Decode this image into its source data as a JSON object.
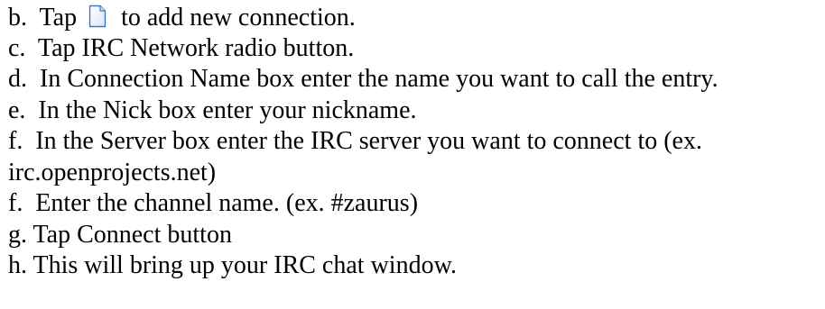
{
  "instructions": {
    "b": {
      "prefix": "b.  Tap ",
      "icon": "new-document-icon",
      "suffix": "  to add new connection."
    },
    "c": "c.  Tap IRC Network radio button.",
    "d": "d.  In Connection Name box enter the name you want to call the entry.",
    "e": "e.  In the Nick box enter your nickname.",
    "f1_line1": "f.  In the Server box enter the IRC server you want to connect to (ex.",
    "f1_line2": "irc.openprojects.net)",
    "f2": "f.  Enter the channel name. (ex. #zaurus)",
    "g": "g. Tap Connect button",
    "h": "h. This will bring up your IRC chat window."
  },
  "colors": {
    "text": "#000000",
    "icon_fill": "#eef4fb",
    "icon_border": "#3b78c7",
    "background": "#ffffff"
  }
}
